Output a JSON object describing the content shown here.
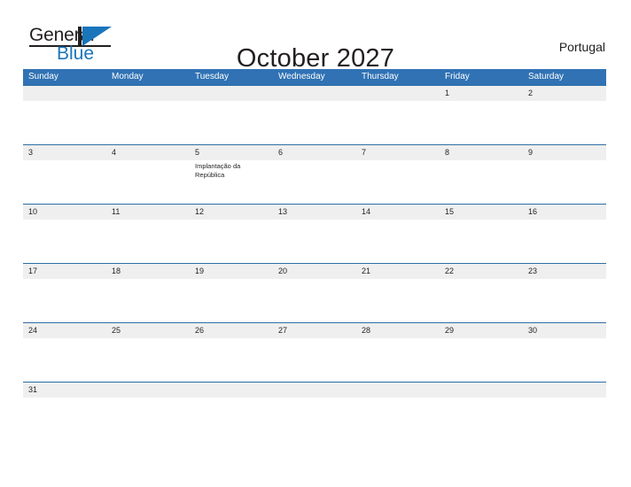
{
  "brand": {
    "name_part1": "General",
    "name_part2": "Blue",
    "logo_icon": "general-blue-triangle-logo"
  },
  "header": {
    "title": "October 2027",
    "country": "Portugal"
  },
  "calendar": {
    "weekdays": [
      "Sunday",
      "Monday",
      "Tuesday",
      "Wednesday",
      "Thursday",
      "Friday",
      "Saturday"
    ],
    "colors": {
      "header_blue": "#3072b4",
      "row_separator": "#2e6da4",
      "date_band_gray": "#efefef",
      "text": "#231f20",
      "brand_blue": "#1b75bb"
    },
    "weeks": [
      {
        "days": [
          {
            "date": "",
            "event": ""
          },
          {
            "date": "",
            "event": ""
          },
          {
            "date": "",
            "event": ""
          },
          {
            "date": "",
            "event": ""
          },
          {
            "date": "",
            "event": ""
          },
          {
            "date": "1",
            "event": ""
          },
          {
            "date": "2",
            "event": ""
          }
        ]
      },
      {
        "days": [
          {
            "date": "3",
            "event": ""
          },
          {
            "date": "4",
            "event": ""
          },
          {
            "date": "5",
            "event": "Implantação da República"
          },
          {
            "date": "6",
            "event": ""
          },
          {
            "date": "7",
            "event": ""
          },
          {
            "date": "8",
            "event": ""
          },
          {
            "date": "9",
            "event": ""
          }
        ]
      },
      {
        "days": [
          {
            "date": "10",
            "event": ""
          },
          {
            "date": "11",
            "event": ""
          },
          {
            "date": "12",
            "event": ""
          },
          {
            "date": "13",
            "event": ""
          },
          {
            "date": "14",
            "event": ""
          },
          {
            "date": "15",
            "event": ""
          },
          {
            "date": "16",
            "event": ""
          }
        ]
      },
      {
        "days": [
          {
            "date": "17",
            "event": ""
          },
          {
            "date": "18",
            "event": ""
          },
          {
            "date": "19",
            "event": ""
          },
          {
            "date": "20",
            "event": ""
          },
          {
            "date": "21",
            "event": ""
          },
          {
            "date": "22",
            "event": ""
          },
          {
            "date": "23",
            "event": ""
          }
        ]
      },
      {
        "days": [
          {
            "date": "24",
            "event": ""
          },
          {
            "date": "25",
            "event": ""
          },
          {
            "date": "26",
            "event": ""
          },
          {
            "date": "27",
            "event": ""
          },
          {
            "date": "28",
            "event": ""
          },
          {
            "date": "29",
            "event": ""
          },
          {
            "date": "30",
            "event": ""
          }
        ]
      },
      {
        "days": [
          {
            "date": "31",
            "event": ""
          },
          {
            "date": "",
            "event": ""
          },
          {
            "date": "",
            "event": ""
          },
          {
            "date": "",
            "event": ""
          },
          {
            "date": "",
            "event": ""
          },
          {
            "date": "",
            "event": ""
          },
          {
            "date": "",
            "event": ""
          }
        ]
      }
    ]
  }
}
